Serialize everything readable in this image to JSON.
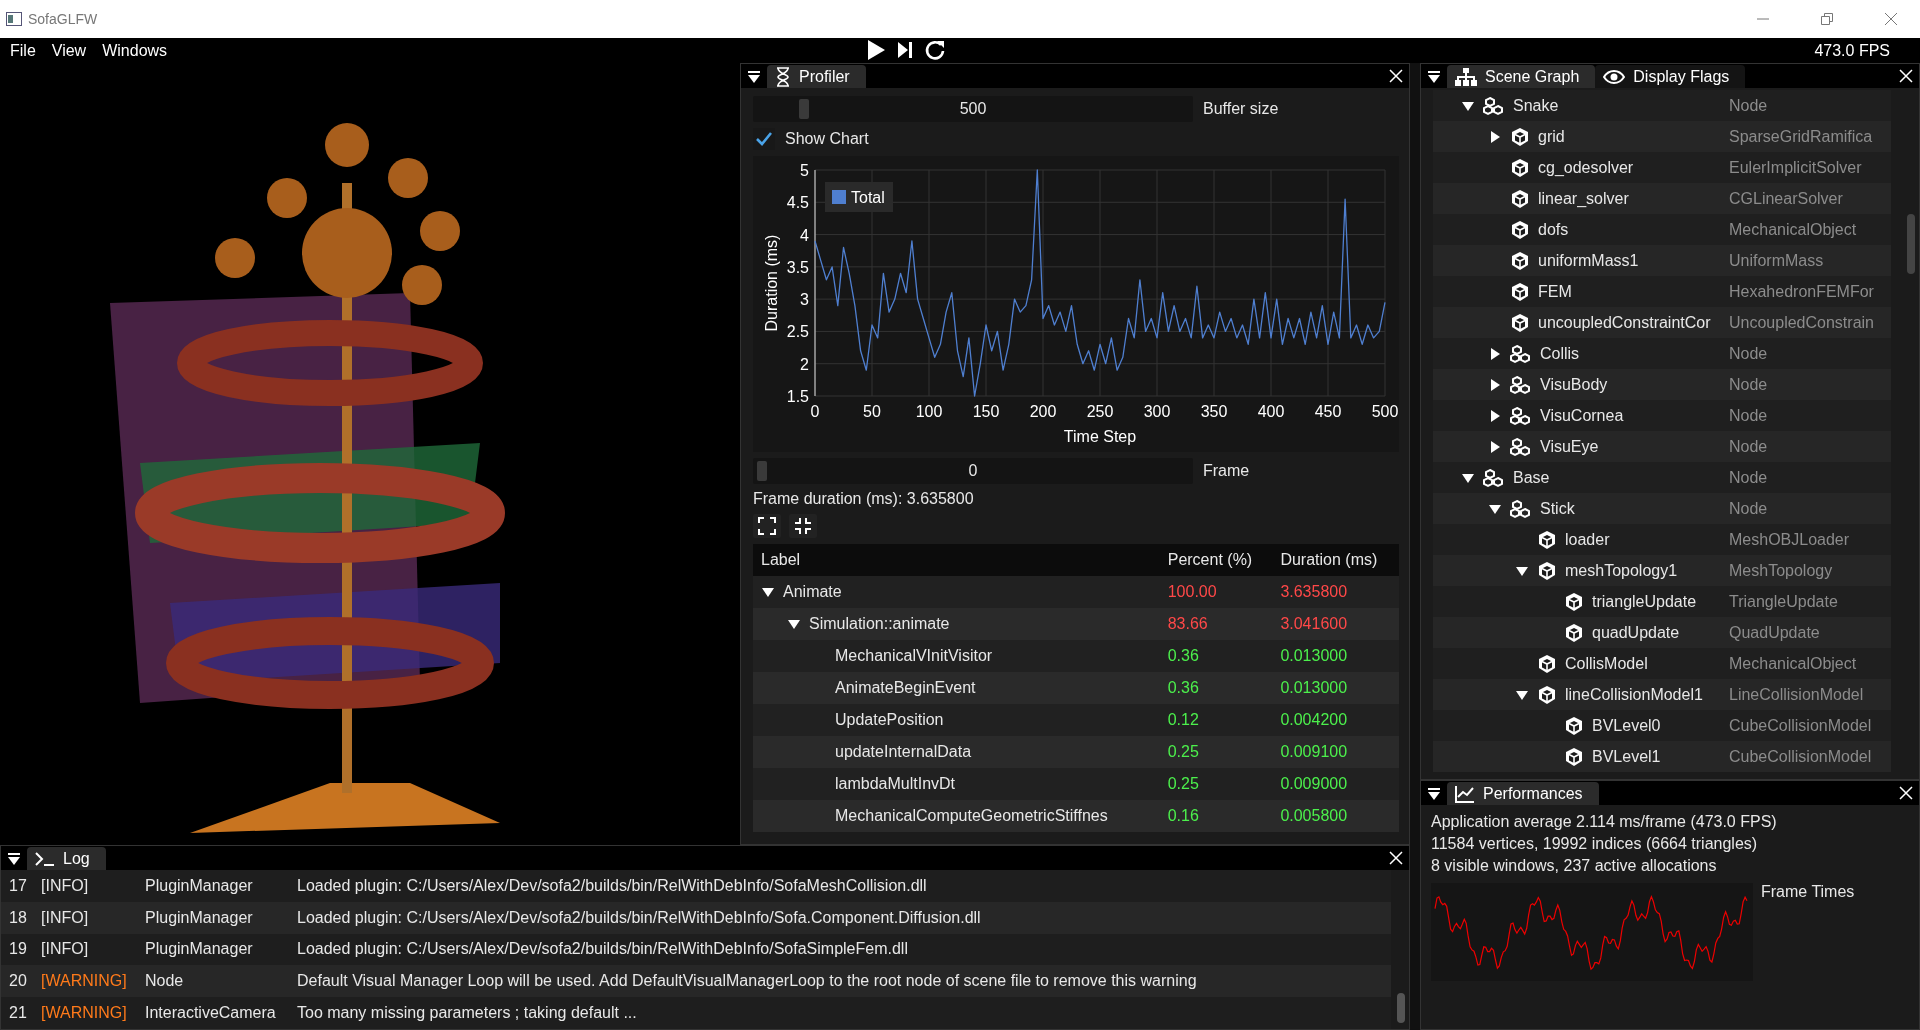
{
  "window": {
    "title": "SofaGLFW"
  },
  "menu": [
    "File",
    "View",
    "Windows"
  ],
  "fps": "473.0 FPS",
  "profiler": {
    "tab": {
      "label": "Profiler",
      "selected": true
    },
    "buffer_size": {
      "value": "500",
      "label": "Buffer size",
      "level": 0.1
    },
    "show_chart": {
      "label": "Show Chart",
      "checked": true
    },
    "chart_data": {
      "type": "line",
      "grid": true,
      "xlabel": "Time Step",
      "ylabel": "Duration (ms)",
      "xlim": [
        0,
        500
      ],
      "ylim": [
        1.5,
        5
      ],
      "xticks": [
        0,
        50,
        100,
        150,
        200,
        250,
        300,
        350,
        400,
        450,
        500
      ],
      "yticks": [
        1.5,
        2,
        2.5,
        3,
        3.5,
        4,
        4.5,
        5
      ],
      "x": [
        0,
        5,
        10,
        15,
        20,
        25,
        30,
        35,
        40,
        45,
        50,
        55,
        60,
        65,
        70,
        75,
        80,
        85,
        90,
        95,
        100,
        105,
        110,
        115,
        120,
        125,
        130,
        135,
        140,
        145,
        150,
        155,
        160,
        165,
        170,
        175,
        180,
        185,
        190,
        195,
        200,
        205,
        210,
        215,
        220,
        225,
        230,
        235,
        240,
        245,
        250,
        255,
        260,
        265,
        270,
        275,
        280,
        285,
        290,
        295,
        300,
        305,
        310,
        315,
        320,
        325,
        330,
        335,
        340,
        345,
        350,
        355,
        360,
        365,
        370,
        375,
        380,
        385,
        390,
        395,
        400,
        405,
        410,
        415,
        420,
        425,
        430,
        435,
        440,
        445,
        450,
        455,
        460,
        465,
        470,
        475,
        480,
        485,
        490,
        495,
        500
      ],
      "series": [
        {
          "name": "Total",
          "color": "#4f7fd0",
          "values": [
            3.9,
            3.6,
            3.3,
            3.5,
            2.9,
            3.8,
            3.4,
            2.9,
            2.2,
            1.9,
            2.6,
            2.4,
            3.4,
            2.8,
            3.0,
            3.4,
            3.1,
            3.9,
            3.0,
            2.7,
            2.4,
            2.1,
            2.3,
            2.8,
            3.1,
            2.2,
            1.8,
            2.4,
            1.5,
            2.0,
            2.6,
            2.2,
            2.5,
            1.9,
            2.3,
            3.0,
            2.8,
            2.9,
            3.3,
            5.0,
            2.7,
            2.9,
            2.6,
            2.8,
            2.5,
            2.9,
            2.3,
            2.0,
            2.2,
            1.9,
            2.3,
            2.0,
            2.4,
            1.9,
            2.1,
            2.7,
            2.4,
            3.3,
            2.5,
            2.7,
            2.4,
            3.1,
            2.5,
            2.9,
            2.5,
            2.7,
            2.4,
            3.2,
            2.4,
            2.6,
            2.4,
            2.8,
            2.5,
            2.7,
            2.4,
            2.6,
            2.3,
            3.0,
            2.4,
            3.1,
            2.4,
            3.0,
            2.3,
            2.7,
            2.4,
            2.7,
            2.3,
            2.8,
            2.4,
            2.9,
            2.3,
            2.8,
            2.4,
            4.55,
            2.4,
            2.6,
            2.3,
            2.6,
            2.4,
            2.5,
            2.95
          ]
        }
      ]
    },
    "frame": {
      "value": "0",
      "label": "Frame",
      "level": 0
    },
    "frame_duration": "Frame duration (ms): 3.635800",
    "table": {
      "columns": [
        "Label",
        "Percent (%)",
        "Duration (ms)"
      ],
      "rows": [
        {
          "label": "Animate",
          "percent": "100.00",
          "duration": "3.635800",
          "color": "#ff4848",
          "expanded": true,
          "children": [
            {
              "label": "Simulation::animate",
              "percent": "83.66",
              "duration": "3.041600",
              "color": "#ff4848",
              "expanded": true,
              "children": [
                {
                  "label": "MechanicalVInitVisitor",
                  "percent": "0.36",
                  "duration": "0.013000",
                  "color": "#4cf04c"
                },
                {
                  "label": "AnimateBeginEvent",
                  "percent": "0.36",
                  "duration": "0.013000",
                  "color": "#4cf04c"
                },
                {
                  "label": "UpdatePosition",
                  "percent": "0.12",
                  "duration": "0.004200",
                  "color": "#4cf04c"
                },
                {
                  "label": "updateInternalData",
                  "percent": "0.25",
                  "duration": "0.009100",
                  "color": "#4cf04c"
                },
                {
                  "label": "lambdaMultInvDt",
                  "percent": "0.25",
                  "duration": "0.009000",
                  "color": "#4cf04c"
                },
                {
                  "label": "MechanicalComputeGeometricStiffnes",
                  "percent": "0.16",
                  "duration": "0.005800",
                  "color": "#4cf04c"
                }
              ]
            }
          ]
        }
      ]
    }
  },
  "scene_graph": {
    "tabs": [
      {
        "label": "Scene Graph",
        "selected": true
      },
      {
        "label": "Display Flags",
        "selected": false
      }
    ],
    "tree": [
      {
        "name": "Snake",
        "type": "Node",
        "kind": "node",
        "expanded": true,
        "children": [
          {
            "name": "grid",
            "type": "SparseGridRamifica",
            "kind": "object",
            "expanded": false
          },
          {
            "name": "cg_odesolver",
            "type": "EulerImplicitSolver",
            "kind": "object"
          },
          {
            "name": "linear_solver",
            "type": "CGLinearSolver",
            "kind": "object"
          },
          {
            "name": "dofs",
            "type": "MechanicalObject",
            "kind": "object"
          },
          {
            "name": "uniformMass1",
            "type": "UniformMass",
            "kind": "object"
          },
          {
            "name": "FEM",
            "type": "HexahedronFEMFor",
            "kind": "object"
          },
          {
            "name": "uncoupledConstraintCor",
            "type": "UncoupledConstrain",
            "kind": "object"
          },
          {
            "name": "Collis",
            "type": "Node",
            "kind": "node",
            "expanded": false
          },
          {
            "name": "VisuBody",
            "type": "Node",
            "kind": "node",
            "expanded": false
          },
          {
            "name": "VisuCornea",
            "type": "Node",
            "kind": "node",
            "expanded": false
          },
          {
            "name": "VisuEye",
            "type": "Node",
            "kind": "node",
            "expanded": false
          }
        ]
      },
      {
        "name": "Base",
        "type": "Node",
        "kind": "node",
        "expanded": true,
        "children": [
          {
            "name": "Stick",
            "type": "Node",
            "kind": "node",
            "expanded": true,
            "children": [
              {
                "name": "loader",
                "type": "MeshOBJLoader",
                "kind": "object"
              },
              {
                "name": "meshTopology1",
                "type": "MeshTopology",
                "kind": "object",
                "expanded": true,
                "children": [
                  {
                    "name": "triangleUpdate",
                    "type": "TriangleUpdate",
                    "kind": "object"
                  },
                  {
                    "name": "quadUpdate",
                    "type": "QuadUpdate",
                    "kind": "object"
                  }
                ]
              },
              {
                "name": "CollisModel",
                "type": "MechanicalObject",
                "kind": "object"
              },
              {
                "name": "lineCollisionModel1",
                "type": "LineCollisionModel",
                "kind": "object",
                "expanded": true,
                "children": [
                  {
                    "name": "BVLevel0",
                    "type": "CubeCollisionModel",
                    "kind": "object"
                  },
                  {
                    "name": "BVLevel1",
                    "type": "CubeCollisionModel",
                    "kind": "object"
                  }
                ]
              }
            ]
          }
        ]
      }
    ]
  },
  "performances": {
    "tab": {
      "label": "Performances",
      "selected": true
    },
    "lines": [
      "Application average 2.114 ms/frame (473.0 FPS)",
      "11584 vertices, 19992 indices (6664 triangles)",
      "8 visible windows, 237 active allocations"
    ],
    "plot_label": "Frame Times"
  },
  "log": {
    "tab": {
      "label": "Log",
      "selected": true
    },
    "rows": [
      {
        "number": "17",
        "level": "[INFO]",
        "kind": "info",
        "source": "PluginManager",
        "message": "Loaded plugin: C:/Users/Alex/Dev/sofa2/builds/bin/RelWithDebInfo/SofaMeshCollision.dll"
      },
      {
        "number": "18",
        "level": "[INFO]",
        "kind": "info",
        "source": "PluginManager",
        "message": "Loaded plugin: C:/Users/Alex/Dev/sofa2/builds/bin/RelWithDebInfo/Sofa.Component.Diffusion.dll"
      },
      {
        "number": "19",
        "level": "[INFO]",
        "kind": "info",
        "source": "PluginManager",
        "message": "Loaded plugin: C:/Users/Alex/Dev/sofa2/builds/bin/RelWithDebInfo/SofaSimpleFem.dll"
      },
      {
        "number": "20",
        "level": "[WARNING]",
        "kind": "warning",
        "source": "Node",
        "message": "Default Visual Manager Loop will be used. Add DefaultVisualManagerLoop to the root node of scene file to remove this warning"
      },
      {
        "number": "21",
        "level": "[WARNING]",
        "kind": "warning",
        "source": "InteractiveCamera",
        "message": "Too many missing parameters ; taking default ..."
      }
    ]
  }
}
